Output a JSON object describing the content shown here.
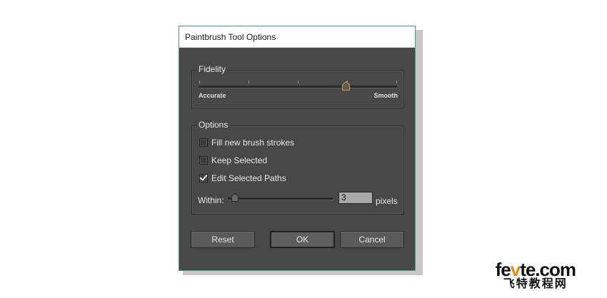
{
  "dialog": {
    "title": "Paintbrush Tool Options",
    "fidelity": {
      "legend": "Fidelity",
      "left_label": "Accurate",
      "right_label": "Smooth",
      "value_fraction": 0.74
    },
    "options": {
      "legend": "Options",
      "checkboxes": [
        {
          "label": "Fill new brush strokes",
          "checked": false
        },
        {
          "label": "Keep Selected",
          "checked": false
        },
        {
          "label": "Edit Selected Paths",
          "checked": true
        }
      ],
      "within": {
        "label": "Within:",
        "value": "3",
        "unit": "pixels",
        "slider_fraction": 0.07
      }
    },
    "buttons": {
      "reset": "Reset",
      "ok": "OK",
      "cancel": "Cancel"
    }
  },
  "watermark": {
    "top_prefix": "fe",
    "top_accent": "v",
    "top_suffix": "te.com",
    "bottom": "飞特教程网"
  }
}
